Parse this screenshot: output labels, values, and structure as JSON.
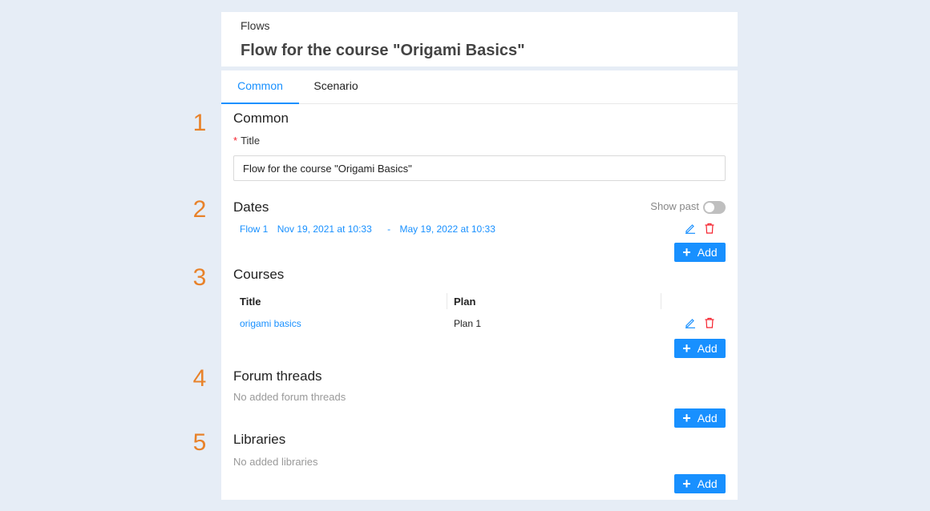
{
  "header": {
    "breadcrumb": "Flows",
    "title": "Flow for the course \"Origami Basics\""
  },
  "tabs": [
    {
      "label": "Common",
      "active": true
    },
    {
      "label": "Scenario",
      "active": false
    }
  ],
  "steps": [
    "1",
    "2",
    "3",
    "4",
    "5"
  ],
  "common": {
    "section_title": "Common",
    "required_mark": "*",
    "title_label": "Title",
    "title_value": "Flow for the course \"Origami Basics\""
  },
  "dates": {
    "section_title": "Dates",
    "show_past_label": "Show past",
    "show_past_enabled": false,
    "items": [
      {
        "name": "Flow 1",
        "start": "Nov 19, 2021 at 10:33",
        "separator": "-",
        "end": "May 19, 2022 at 10:33"
      }
    ],
    "add_label": "Add"
  },
  "courses": {
    "section_title": "Courses",
    "columns": [
      "Title",
      "Plan"
    ],
    "rows": [
      {
        "title": "origami basics",
        "plan": "Plan 1"
      }
    ],
    "add_label": "Add"
  },
  "forum": {
    "section_title": "Forum threads",
    "empty_text": "No added forum threads",
    "add_label": "Add"
  },
  "libraries": {
    "section_title": "Libraries",
    "empty_text": "No added libraries",
    "add_label": "Add"
  },
  "colors": {
    "accent": "#1890ff",
    "danger": "#f5222d",
    "step_number": "#e8822a",
    "background": "#e6edf6"
  },
  "icons": {
    "edit": "pencil-icon",
    "delete": "trash-icon",
    "add": "plus-icon"
  }
}
